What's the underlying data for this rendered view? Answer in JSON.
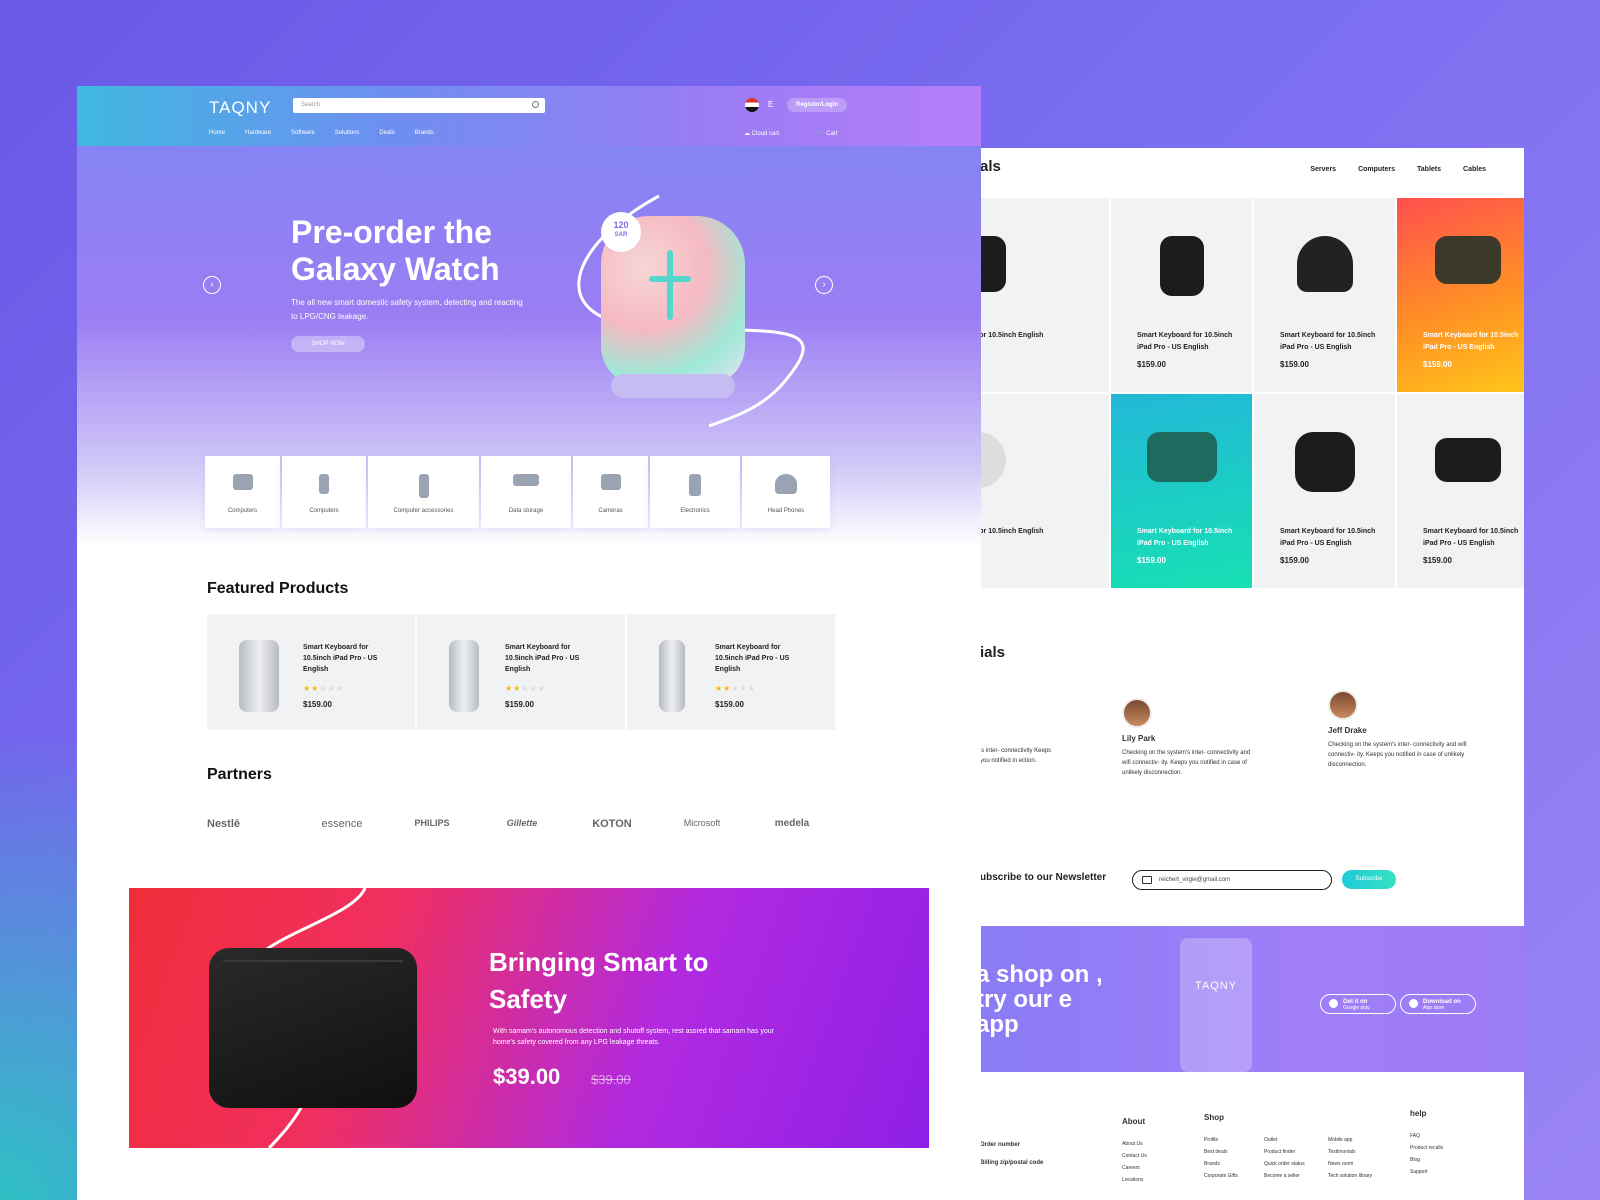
{
  "colors": {
    "accent": "#8a7cf5",
    "teal": "#1ecbd8",
    "promo_red": "#ef2e3a",
    "promo_purple": "#8e1fe6",
    "star": "#f5b800"
  },
  "header": {
    "logo": "TAQNY",
    "search_placeholder": "Search",
    "lang": "E",
    "register": "Register/Login",
    "nav": [
      "Home",
      "Hardware",
      "Software",
      "Solutions",
      "Deals",
      "Brands"
    ],
    "cloud_cart": "Cloud cart",
    "cart": "Cart"
  },
  "hero": {
    "title": "Pre-order the Galaxy Watch",
    "subtitle": "The all new smart domestic safety system, detecting and reacting to LPG/CNG leakage.",
    "cta": "SHOP NOW",
    "badge_value": "120",
    "badge_unit": "SAR",
    "prev_icon": "chevron-left-icon",
    "next_icon": "chevron-right-icon"
  },
  "categories": [
    "Computers",
    "Computers",
    "Computer accessories",
    "Data storage",
    "Cameras",
    "Electronics",
    "Head Phones"
  ],
  "featured": {
    "title": "Featured Products",
    "items": [
      {
        "name": "Smart Keyboard for 10.5inch iPad Pro - US English",
        "price": "$159.00",
        "rating": 2
      },
      {
        "name": "Smart Keyboard for 10.5inch iPad Pro - US English",
        "price": "$159.00",
        "rating": 2
      },
      {
        "name": "Smart Keyboard for 10.5inch iPad Pro - US English",
        "price": "$159.00",
        "rating": 2
      }
    ]
  },
  "partners": {
    "title": "Partners",
    "items": [
      "Nestlē",
      "essence",
      "PHILIPS",
      "Gillette",
      "KOTON",
      "Microsoft",
      "medela"
    ]
  },
  "promo": {
    "title": "Bringing Smart to Safety",
    "subtitle": "With samam's autonomous detection and shutoff system, rest assred that samam has your home's safety covered from any LPG leakage threats.",
    "price": "$39.00",
    "old_price": "$39.00"
  },
  "back": {
    "deals_title": "als",
    "tabs": [
      "Servers",
      "Computers",
      "Tablets",
      "Cables"
    ],
    "grid": [
      {
        "name": "rd for 10.5inch English",
        "price": ""
      },
      {
        "name": "Smart Keyboard for 10.5inch iPad Pro - US English",
        "price": "$159.00"
      },
      {
        "name": "Smart Keyboard for 10.5inch iPad Pro - US English",
        "price": "$159.00"
      },
      {
        "name": "Smart Keyboard for 10.5inch iPad Pro - US English",
        "price": "$159.00"
      },
      {
        "name": "rd for 10.5inch English",
        "price": ""
      },
      {
        "name": "Smart Keyboard for 10.5inch iPad Pro - US English",
        "price": "$159.00"
      },
      {
        "name": "Smart Keyboard for 10.5inch iPad Pro - US English",
        "price": "$159.00"
      },
      {
        "name": "Smart Keyboard for 10.5inch iPad Pro - US English",
        "price": "$159.00"
      }
    ],
    "testimonials_title": "ials",
    "testimonials": [
      {
        "name": "",
        "text": "'s inter- connectivity Keeps you notified in ection."
      },
      {
        "name": "Lily Park",
        "text": "Checking on the system's inter- connectivity and wifi connectiv- ity. Keeps you notified in case of unlikely disconnection."
      },
      {
        "name": "Jeff Drake",
        "text": "Checking on the system's inter- connectivity and wifi connectiv- ity. Keeps you notified in case of unlikely disconnection."
      }
    ],
    "newsletter": {
      "label": "ubscribe to our Newsletter",
      "value": "reichert_virgie@gmail.com",
      "button": "Subscribe"
    },
    "app": {
      "text": "a shop on , try our e app",
      "phone_logo": "TAQNY",
      "google_top": "Get it on",
      "google_bottom": "Google play",
      "apple_top": "Download on",
      "apple_bottom": "App store"
    },
    "footer": {
      "left": [
        "Order number",
        "Billing zip/postal code"
      ],
      "about": {
        "title": "About",
        "items": [
          "About Us",
          "Contact Us",
          "Careers",
          "Locations"
        ]
      },
      "shop": {
        "title": "Shop",
        "items": [
          "Profile",
          "Best deals",
          "Brands",
          "Corporate Gifts"
        ],
        "items2": [
          "Outlet",
          "Product finder",
          "Quick order status",
          "Become a seller"
        ],
        "items3": [
          "Mobile app",
          "Testimonials",
          "News room",
          "Tech solution library"
        ]
      },
      "help": {
        "title": "help",
        "items": [
          "FAQ",
          "Product recalls",
          "Blog",
          "Support"
        ]
      }
    }
  }
}
